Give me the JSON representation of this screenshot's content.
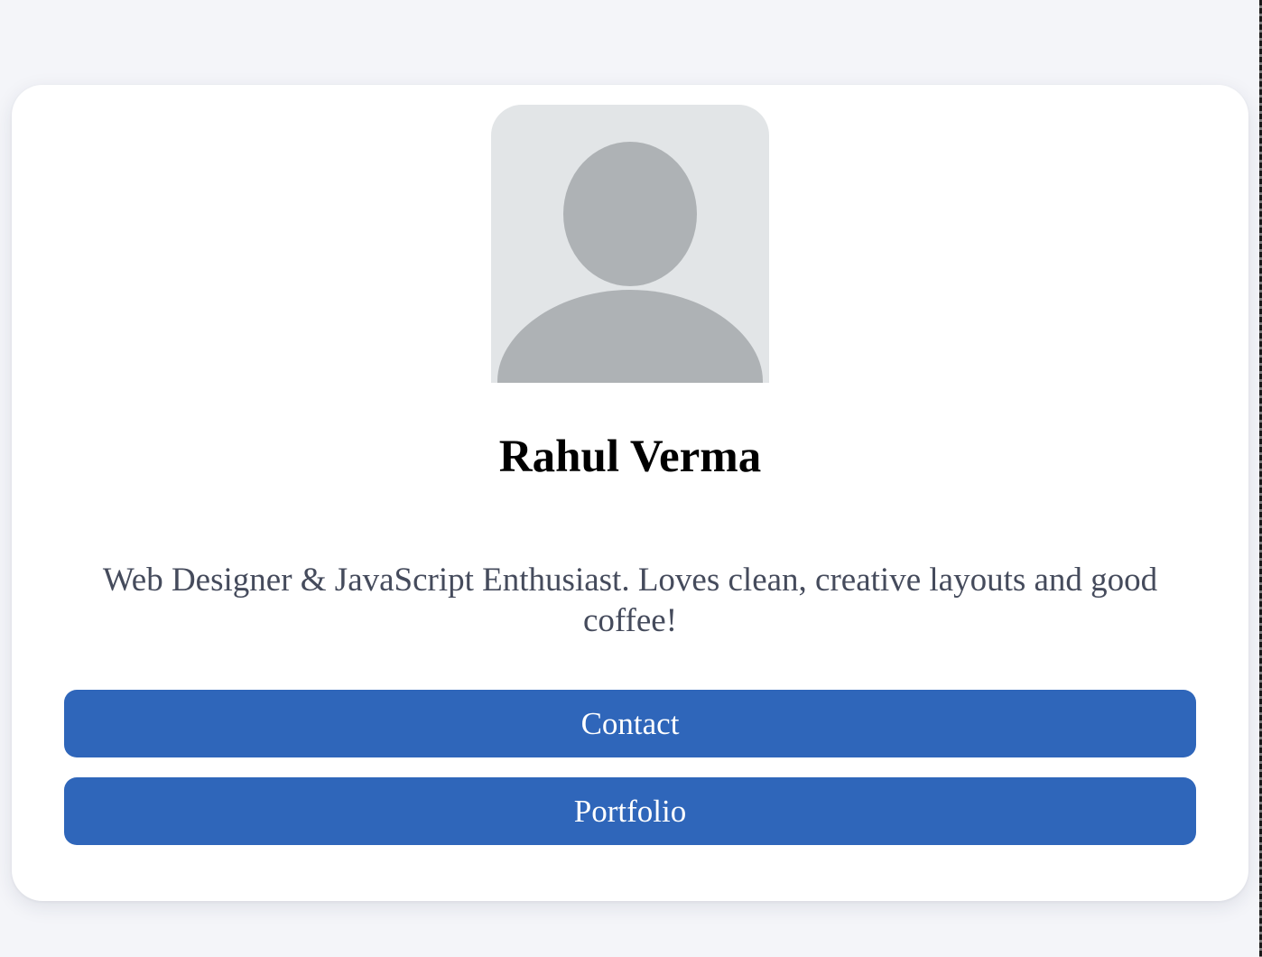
{
  "profile": {
    "name": "Rahul Verma",
    "bio": "Web Designer & JavaScript Enthusiast. Loves clean, creative layouts and good coffee!",
    "avatar_icon": "user-silhouette-icon"
  },
  "actions": {
    "contact_label": "Contact",
    "portfolio_label": "Portfolio"
  },
  "colors": {
    "page_background": "#f4f5f9",
    "card_background": "#ffffff",
    "button_background": "#2f66ba",
    "button_text": "#ffffff",
    "bio_text": "#454b5c",
    "avatar_background": "#e2e5e7",
    "avatar_silhouette": "#aeb2b5"
  }
}
